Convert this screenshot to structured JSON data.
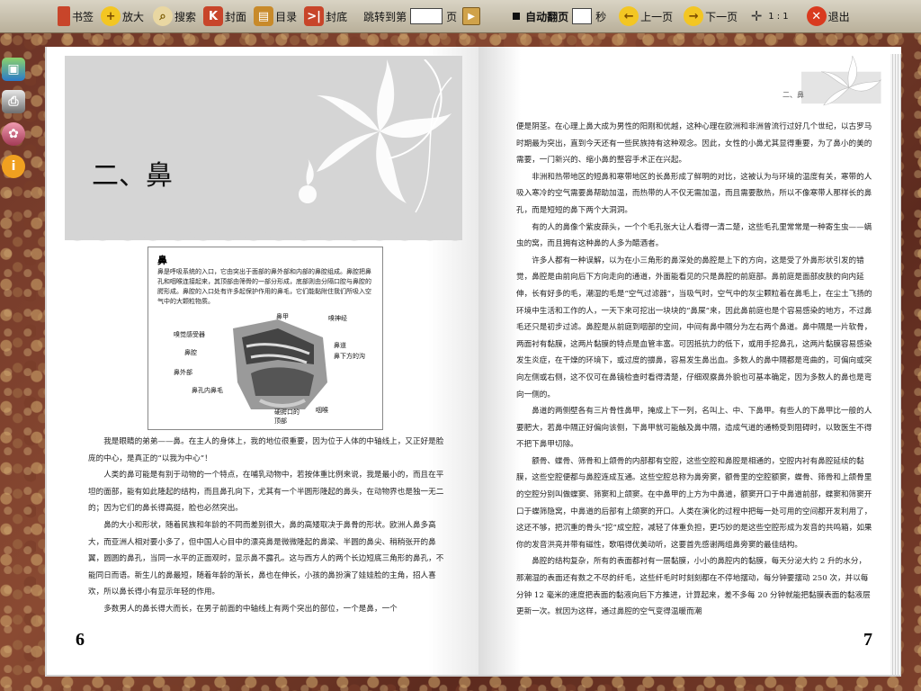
{
  "toolbar": {
    "bookmark": "书签",
    "zoom": "放大",
    "search": "搜索",
    "cover": "封面",
    "toc": "目录",
    "back_cover": "封底",
    "jump_to": "跳转到第",
    "page_unit": "页",
    "auto_flip": "自动翻页",
    "seconds": "秒",
    "prev": "上一页",
    "next": "下一页",
    "ratio": "1 : 1",
    "exit": "退出"
  },
  "left_page": {
    "chapter_title": "二、鼻",
    "page_number": "6",
    "figure": {
      "title": "鼻",
      "description": "鼻是呼吸系统的入口，它由突出于面部的鼻外部和内部的鼻腔组成。鼻腔把鼻孔和咽喉连接起来，其顶部由筛骨的一部分形成，底部则由分隔口腔与鼻腔的腭形成。鼻腔的入口处有许多起保护作用的鼻毛，它们能黏附住我们所吸入空气中的大颗粒物质。",
      "labels": [
        "鼻甲",
        "嗅神经",
        "嗅觉感受器",
        "鼻道",
        "鼻腔",
        "鼻下方的沟",
        "鼻外部",
        "鼻孔内鼻毛",
        "硬腭口的顶部",
        "咽喉"
      ]
    },
    "paragraphs": [
      "我是眼睛的弟弟——鼻。在主人的身体上，我的地位很重要，因为位于人体的中轴线上，又正好是脸庞的中心，是真正的“以我为中心”！",
      "人类的鼻可能是有别于动物的一个特点，在哺乳动物中，若按体重比例来说，我是最小的，而且在平坦的面部，能有如此隆起的结构，而且鼻孔向下，尤其有一个半圆形隆起的鼻头，在动物界也是独一无二的；因为它们的鼻长得高挺，脸也必然突出。",
      "鼻的大小和形状，随着民族和年龄的不同而差别很大，鼻的高矮取决于鼻骨的形状。欧洲人鼻多高大，而亚洲人相对要小多了，但中国人心目中的漂亮鼻是微微隆起的鼻梁、半圆的鼻尖、稍稍张开的鼻翼，圆圆的鼻孔，当同一水平的正面观时，显示鼻不露孔。这与西方人的两个长边短底三角形的鼻孔，不能同日而语。新生儿的鼻最短，随着年龄的渐长，鼻也在伸长，小孩的鼻扮演了娃娃脸的主角，招人喜欢，所以鼻长得小有显示年轻的作用。",
      "多数男人的鼻长得大而长，在男子前面的中轴线上有两个突出的部位，一个是鼻，一个"
    ]
  },
  "right_page": {
    "header_label": "二、鼻",
    "page_number": "7",
    "paragraphs": [
      {
        "indent": false,
        "text": "便是阴茎。在心理上鼻大成为男性的阳刚和优越，这种心理在欧洲和非洲曾流行过好几个世纪，以古罗马时期最为突出，直到今天还有一些民族持有这种观念。因此，女性的小鼻尤其显得重要，为了鼻小的美的需要，一门新兴的、缩小鼻的整容手术正在兴起。"
      },
      {
        "indent": true,
        "text": "非洲和热带地区的短鼻和寒带地区的长鼻形成了鲜明的对比，这被认为与环境的温度有关，寒带的人吸入寒冷的空气需要鼻帮助加温，而热带的人不仅无需加温，而且需要散热，所以不像寒带人那样长的鼻孔，而是短短的鼻下两个大洞洞。"
      },
      {
        "indent": true,
        "text": "有的人的鼻像个紫皮蒜头，一个个毛孔张大让人看得一清二楚，这些毛孔里常常是一种寄生虫——螨虫的窝，而且拥有这种鼻的人多为醋酒者。"
      },
      {
        "indent": true,
        "text": "许多人都有一种误解，以为在小三角形的鼻深处的鼻腔是上下的方向，这是受了外鼻形状引发的错觉，鼻腔是由前向后下方向走向的通道，外面能看见的只是鼻腔的前庭部。鼻前庭是面部皮肤的向内延伸，长有好多的毛，潮湿的毛是“空气过滤器”，当吸气时，空气中的灰尘颗粒着在鼻毛上，在尘土飞扬的环境中生活和工作的人，一天下来可挖出一块块的“鼻屎”来，因此鼻前庭也是个容易感染的地方，不过鼻毛还只是初步过滤。鼻腔是从前庭到咽部的空间，中间有鼻中隔分为左右两个鼻道。鼻中隔是一片软骨，两面衬有黏膜，这两片黏膜的特点是血管丰富。可因抵抗力的低下，或用手挖鼻孔，这两片黏膜容易感染发生炎症，在干燥的环境下，或过度的擤鼻，容易发生鼻出血。多数人的鼻中隔都是弯曲的，可偏向或突向左侧或右侧，这不仅可在鼻镜检查时看得清楚，仔细观察鼻外貌也可基本确定，因为多数人的鼻也是弯向一侧的。"
      },
      {
        "indent": true,
        "text": "鼻道的两侧壁各有三片骨性鼻甲，掩成上下一列，名叫上、中、下鼻甲。有些人的下鼻甲比一般的人要肥大，若鼻中隔正好偏向该侧，下鼻甲就可能触及鼻中隔，造成气道的通畅受到阻碍时，以致医生不得不把下鼻甲切除。"
      },
      {
        "indent": true,
        "text": "额骨、蝶骨、筛骨和上颌骨的内部都有空腔，这些空腔和鼻腔是相通的，空腔内衬有鼻腔延续的黏膜，这些空腔便都与鼻腔连成互通。这些空腔总称为鼻旁窦，额骨里的空腔额窦，蝶骨、筛骨和上颌骨里的空腔分别叫做蝶窦、筛窦和上颌窦。在中鼻甲的上方为中鼻道，额窦开口于中鼻道前部，蝶窦和筛窦开口于蝶筛隐窝，中鼻道的后部有上颌窦的开口。人类在演化的过程中把每一处可用的空间都开发利用了，这还不够，把沉重的骨头“挖”成空腔，减轻了体重负担，更巧妙的是这些空腔形成为发音的共鸣箱，如果你的发音洪亮并带有磁性，歌唱得优美动听，这要首先感谢两组鼻旁窦的最佳结构。"
      },
      {
        "indent": true,
        "text": "鼻腔的结构复杂，所有的表面都衬有一层黏膜，小小的鼻腔内的黏膜，每天分泌大约 2 升的水分，那潮湿的表面还有数之不尽的纤毛，这些纤毛时时刻刻都在不停地摆动，每分钟要摆动 250 次，并以每分钟 12 毫米的速度把表面的黏液向后下方推进，计算起来，差不多每 20 分钟就能把黏膜表面的黏液层更新一次。就因为这样，通过鼻腔的空气变得温暖而潮"
      }
    ]
  }
}
